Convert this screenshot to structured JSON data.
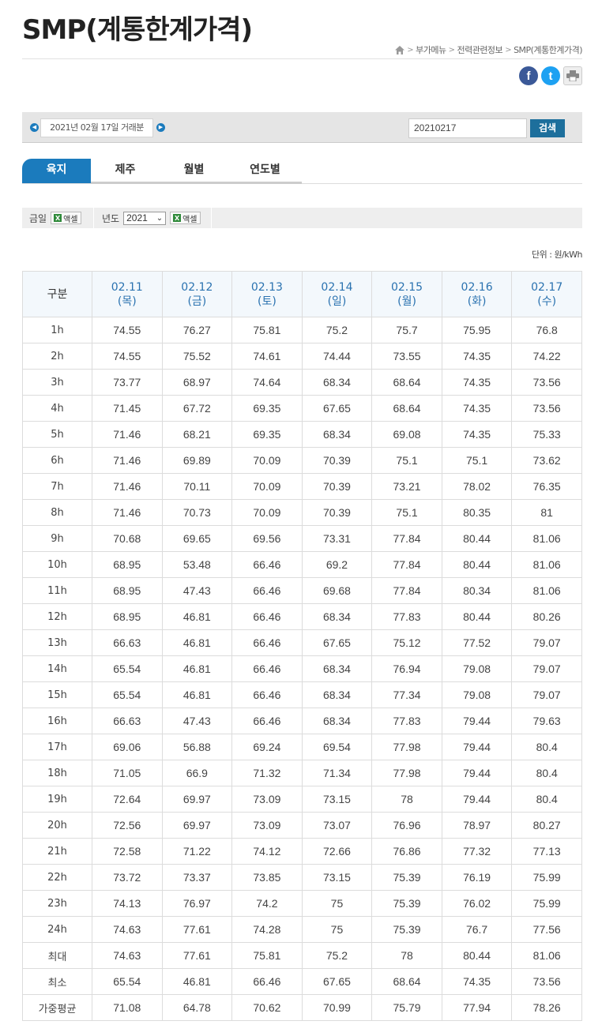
{
  "page": {
    "title": "SMP(계통한계가격)",
    "breadcrumb": [
      "부가메뉴",
      "전력관련정보",
      "SMP(계통한계가격)"
    ]
  },
  "share": {
    "facebook": "f",
    "twitter": "t",
    "print": "⎙"
  },
  "date_bar": {
    "label": "2021년 02월 17일 거래분",
    "input_value": "20210217",
    "search_label": "검색"
  },
  "tabs": [
    {
      "label": "육지",
      "active": true
    },
    {
      "label": "제주",
      "active": false
    },
    {
      "label": "월별",
      "active": false
    },
    {
      "label": "연도별",
      "active": false
    }
  ],
  "excel_bar": {
    "today_label": "금일",
    "excel_label": "액셀",
    "year_label": "년도",
    "year_value": "2021",
    "excel_label2": "액셀"
  },
  "unit": "단위 : 원/kWh",
  "table": {
    "corner": "구분",
    "columns": [
      {
        "date": "02.11",
        "day": "(목)"
      },
      {
        "date": "02.12",
        "day": "(금)"
      },
      {
        "date": "02.13",
        "day": "(토)"
      },
      {
        "date": "02.14",
        "day": "(일)"
      },
      {
        "date": "02.15",
        "day": "(월)"
      },
      {
        "date": "02.16",
        "day": "(화)"
      },
      {
        "date": "02.17",
        "day": "(수)"
      }
    ],
    "rows": [
      {
        "label": "1h",
        "values": [
          "74.55",
          "76.27",
          "75.81",
          "75.2",
          "75.7",
          "75.95",
          "76.8"
        ]
      },
      {
        "label": "2h",
        "values": [
          "74.55",
          "75.52",
          "74.61",
          "74.44",
          "73.55",
          "74.35",
          "74.22"
        ]
      },
      {
        "label": "3h",
        "values": [
          "73.77",
          "68.97",
          "74.64",
          "68.34",
          "68.64",
          "74.35",
          "73.56"
        ]
      },
      {
        "label": "4h",
        "values": [
          "71.45",
          "67.72",
          "69.35",
          "67.65",
          "68.64",
          "74.35",
          "73.56"
        ]
      },
      {
        "label": "5h",
        "values": [
          "71.46",
          "68.21",
          "69.35",
          "68.34",
          "69.08",
          "74.35",
          "75.33"
        ]
      },
      {
        "label": "6h",
        "values": [
          "71.46",
          "69.89",
          "70.09",
          "70.39",
          "75.1",
          "75.1",
          "73.62"
        ]
      },
      {
        "label": "7h",
        "values": [
          "71.46",
          "70.11",
          "70.09",
          "70.39",
          "73.21",
          "78.02",
          "76.35"
        ]
      },
      {
        "label": "8h",
        "values": [
          "71.46",
          "70.73",
          "70.09",
          "70.39",
          "75.1",
          "80.35",
          "81"
        ]
      },
      {
        "label": "9h",
        "values": [
          "70.68",
          "69.65",
          "69.56",
          "73.31",
          "77.84",
          "80.44",
          "81.06"
        ]
      },
      {
        "label": "10h",
        "values": [
          "68.95",
          "53.48",
          "66.46",
          "69.2",
          "77.84",
          "80.44",
          "81.06"
        ]
      },
      {
        "label": "11h",
        "values": [
          "68.95",
          "47.43",
          "66.46",
          "69.68",
          "77.84",
          "80.34",
          "81.06"
        ]
      },
      {
        "label": "12h",
        "values": [
          "68.95",
          "46.81",
          "66.46",
          "68.34",
          "77.83",
          "80.44",
          "80.26"
        ]
      },
      {
        "label": "13h",
        "values": [
          "66.63",
          "46.81",
          "66.46",
          "67.65",
          "75.12",
          "77.52",
          "79.07"
        ]
      },
      {
        "label": "14h",
        "values": [
          "65.54",
          "46.81",
          "66.46",
          "68.34",
          "76.94",
          "79.08",
          "79.07"
        ]
      },
      {
        "label": "15h",
        "values": [
          "65.54",
          "46.81",
          "66.46",
          "68.34",
          "77.34",
          "79.08",
          "79.07"
        ]
      },
      {
        "label": "16h",
        "values": [
          "66.63",
          "47.43",
          "66.46",
          "68.34",
          "77.83",
          "79.44",
          "79.63"
        ]
      },
      {
        "label": "17h",
        "values": [
          "69.06",
          "56.88",
          "69.24",
          "69.54",
          "77.98",
          "79.44",
          "80.4"
        ]
      },
      {
        "label": "18h",
        "values": [
          "71.05",
          "66.9",
          "71.32",
          "71.34",
          "77.98",
          "79.44",
          "80.4"
        ]
      },
      {
        "label": "19h",
        "values": [
          "72.64",
          "69.97",
          "73.09",
          "73.15",
          "78",
          "79.44",
          "80.4"
        ]
      },
      {
        "label": "20h",
        "values": [
          "72.56",
          "69.97",
          "73.09",
          "73.07",
          "76.96",
          "78.97",
          "80.27"
        ]
      },
      {
        "label": "21h",
        "values": [
          "72.58",
          "71.22",
          "74.12",
          "72.66",
          "76.86",
          "77.32",
          "77.13"
        ]
      },
      {
        "label": "22h",
        "values": [
          "73.72",
          "73.37",
          "73.85",
          "73.15",
          "75.39",
          "76.19",
          "75.99"
        ]
      },
      {
        "label": "23h",
        "values": [
          "74.13",
          "76.97",
          "74.2",
          "75",
          "75.39",
          "76.02",
          "75.99"
        ]
      },
      {
        "label": "24h",
        "values": [
          "74.63",
          "77.61",
          "74.28",
          "75",
          "75.39",
          "76.7",
          "77.56"
        ]
      },
      {
        "label": "최대",
        "values": [
          "74.63",
          "77.61",
          "75.81",
          "75.2",
          "78",
          "80.44",
          "81.06"
        ]
      },
      {
        "label": "최소",
        "values": [
          "65.54",
          "46.81",
          "66.46",
          "67.65",
          "68.64",
          "74.35",
          "73.56"
        ]
      },
      {
        "label": "가중평균",
        "values": [
          "71.08",
          "64.78",
          "70.62",
          "70.99",
          "75.79",
          "77.94",
          "78.26"
        ]
      }
    ]
  },
  "colors": {
    "accent": "#1b7bbd",
    "search_button": "#1d6f9c",
    "header_text": "#2a72b0",
    "facebook": "#3b5998",
    "twitter": "#1da1f2"
  }
}
